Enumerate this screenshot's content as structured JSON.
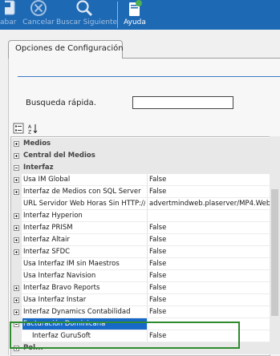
{
  "toolbar": {
    "buttons": [
      {
        "label": "abar",
        "icon": "save-icon"
      },
      {
        "label": "Cancelar",
        "icon": "cancel-icon"
      },
      {
        "label": "Buscar Siguiente",
        "icon": "search-icon"
      },
      {
        "label": "Ayuda",
        "icon": "help-book-icon"
      }
    ]
  },
  "tab": {
    "label": "Opciones de Configuración"
  },
  "search": {
    "label": "Busqueda rápida.",
    "value": "",
    "placeholder": ""
  },
  "grid_tools": [
    "categorized-view-icon",
    "alphabetical-sort-icon"
  ],
  "grid": {
    "rows": [
      {
        "type": "category",
        "name": "Medios",
        "expanded": false
      },
      {
        "type": "category",
        "name": "Central del Medios",
        "expanded": false
      },
      {
        "type": "category",
        "name": "Interfaz",
        "expanded": true
      },
      {
        "type": "property",
        "name": "Usa IM Global",
        "value": "False",
        "expander": true
      },
      {
        "type": "property",
        "name": "Interfaz de Medios con SQL Server",
        "value": "False",
        "expander": true
      },
      {
        "type": "property",
        "name": "URL Servidor Web Horas Sin HTTP://",
        "value": "advertmindweb.plaserver/MP4.Web/L",
        "expander": false
      },
      {
        "type": "property",
        "name": "Interfaz Hyperion",
        "value": "",
        "expander": true
      },
      {
        "type": "property",
        "name": "Interfaz PRISM",
        "value": "False",
        "expander": true
      },
      {
        "type": "property",
        "name": "Interfaz Altair",
        "value": "False",
        "expander": true
      },
      {
        "type": "property",
        "name": "Interfaz SFDC",
        "value": "False",
        "expander": true
      },
      {
        "type": "property",
        "name": "Usa Interfaz IM sin Maestros",
        "value": "False",
        "expander": false
      },
      {
        "type": "property",
        "name": "Usa Interfaz Navision",
        "value": "False",
        "expander": false
      },
      {
        "type": "property",
        "name": "Interfaz Bravo Reports",
        "value": "False",
        "expander": true
      },
      {
        "type": "property",
        "name": "Usa Interfaz Instar",
        "value": "False",
        "expander": true
      },
      {
        "type": "property",
        "name": "Interfaz Dynamics Contabilidad",
        "value": "False",
        "expander": true
      },
      {
        "type": "property",
        "name": "Facturación Dominicana",
        "value": "",
        "expander": true,
        "expanded": true,
        "selected": true
      },
      {
        "type": "property",
        "name": "Interfaz GuruSoft",
        "value": "False",
        "expander": false,
        "indent": true
      },
      {
        "type": "category",
        "name": "Pol...",
        "expanded": false
      }
    ]
  },
  "colors": {
    "toolbar": "#1e69b4",
    "selection": "#1769c7",
    "highlight": "#2e8b2e"
  }
}
